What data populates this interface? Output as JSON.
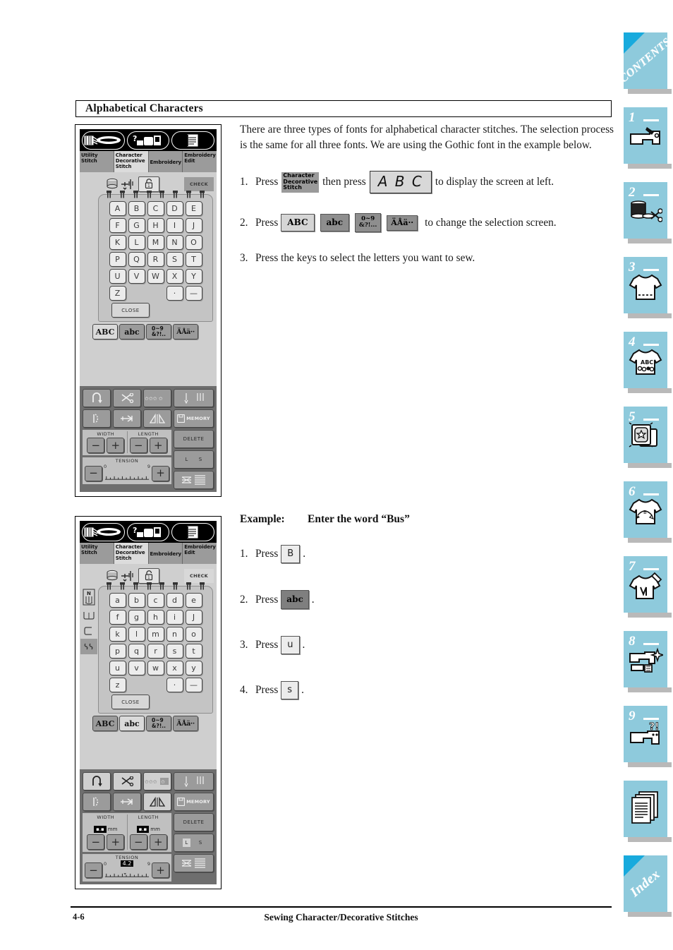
{
  "section": {
    "heading": "Alphabetical Characters"
  },
  "intro": {
    "paragraph": "There are three types of fonts for alphabetical character stitches. The selection process is the same for all three fonts. We are using the Gothic font in the example below."
  },
  "steps": [
    {
      "num": "1.",
      "lead": "Press",
      "chip1_line1": "Character",
      "chip1_line2": "Decorative",
      "chip1_line3": "Stitch",
      "mid": "then press",
      "chip2": "A B C",
      "tail": "to display the screen at left."
    },
    {
      "num": "2.",
      "lead": "Press",
      "keys": [
        "ABC",
        "abc",
        "0~9 &?!...",
        "ÄÅä··"
      ],
      "tail": "to change the selection screen."
    },
    {
      "num": "3.",
      "text": "Press the keys to select the letters you want to sew."
    }
  ],
  "example": {
    "label": "Example:",
    "title": "Enter the word “Bus”",
    "steps": [
      {
        "num": "1.",
        "lead": "Press",
        "key": "B",
        "style": "light",
        "tail": "."
      },
      {
        "num": "2.",
        "lead": "Press",
        "key": "abc",
        "style": "dark",
        "tail": "."
      },
      {
        "num": "3.",
        "lead": "Press",
        "key": "u",
        "style": "light",
        "tail": "."
      },
      {
        "num": "4.",
        "lead": "Press",
        "key": "s",
        "style": "light",
        "tail": "."
      }
    ]
  },
  "lcd1": {
    "tabs": [
      {
        "l1": "Utility",
        "l2": "Stitch",
        "l3": "",
        "active": false
      },
      {
        "l1": "Character",
        "l2": "Decorative",
        "l3": "Stitch",
        "active": true
      },
      {
        "l1": "Embroidery",
        "l2": "",
        "l3": "",
        "active": false
      },
      {
        "l1": "Embroidery",
        "l2": "Edit",
        "l3": "",
        "active": false
      }
    ],
    "check_label": "CHECK",
    "keys": [
      [
        "A",
        "B",
        "C",
        "D",
        "E"
      ],
      [
        "F",
        "G",
        "H",
        "I",
        "J"
      ],
      [
        "K",
        "L",
        "M",
        "N",
        "O"
      ],
      [
        "P",
        "Q",
        "R",
        "S",
        "T"
      ],
      [
        "U",
        "V",
        "W",
        "X",
        "Y"
      ],
      [
        "Z",
        "",
        "",
        "·",
        "—"
      ]
    ],
    "close_label": "CLOSE",
    "fontkeys": [
      {
        "label": "ABC",
        "kind": "light"
      },
      {
        "label": "abc",
        "kind": "dark"
      },
      {
        "label": "0~9\n&?!...",
        "kind": "dark"
      },
      {
        "label": "ÄÅä··",
        "kind": "dark"
      }
    ],
    "deck": {
      "memory_label": "MEMORY",
      "width_label": "WIDTH",
      "length_label": "LENGTH",
      "width_value": "",
      "length_value": "",
      "mm_unit": "",
      "tension_label": "TENSION",
      "tension_min": "0",
      "tension_max": "9",
      "tension_value": "",
      "minus": "−",
      "plus": "+",
      "delete_label": "DELETE",
      "l_label": "L",
      "s_label": "S",
      "l_selected": false
    }
  },
  "lcd2": {
    "tabs": [
      {
        "l1": "Utility",
        "l2": "Stitch",
        "l3": "",
        "active": false
      },
      {
        "l1": "Character",
        "l2": "Decorative",
        "l3": "Stitch",
        "active": true
      },
      {
        "l1": "Embroidery",
        "l2": "",
        "l3": "",
        "active": false
      },
      {
        "l1": "Embroidery",
        "l2": "Edit",
        "l3": "",
        "active": false
      }
    ],
    "check_label": "CHECK",
    "presser_foot_label": "N",
    "keys": [
      [
        "a",
        "b",
        "c",
        "d",
        "e"
      ],
      [
        "f",
        "g",
        "h",
        "i",
        "J"
      ],
      [
        "k",
        "l",
        "m",
        "n",
        "o"
      ],
      [
        "p",
        "q",
        "r",
        "s",
        "t"
      ],
      [
        "u",
        "v",
        "w",
        "x",
        "y"
      ],
      [
        "z",
        "",
        "",
        "·",
        "—"
      ]
    ],
    "close_label": "CLOSE",
    "fontkeys": [
      {
        "label": "ABC",
        "kind": "dark"
      },
      {
        "label": "abc",
        "kind": "light"
      },
      {
        "label": "0~9\n&?!...",
        "kind": "dark"
      },
      {
        "label": "ÄÅä··",
        "kind": "dark"
      }
    ],
    "deck": {
      "memory_label": "MEMORY",
      "width_label": "WIDTH",
      "length_label": "LENGTH",
      "width_value": "▪.▪",
      "length_value": "▪.▪",
      "mm_unit": "mm",
      "tension_label": "TENSION",
      "tension_min": "0",
      "tension_max": "9",
      "tension_value": "4.2",
      "minus": "−",
      "plus": "+",
      "delete_label": "DELETE",
      "l_label": "L",
      "s_label": "S",
      "l_selected": true
    }
  },
  "sidetabs": [
    {
      "kind": "text",
      "label": "CONTENTS"
    },
    {
      "kind": "num",
      "label": "1",
      "icon": "sewing-machine-icon"
    },
    {
      "kind": "num",
      "label": "2",
      "icon": "spool-scissors-icon"
    },
    {
      "kind": "num",
      "label": "3",
      "icon": "tshirt-stitch-icon"
    },
    {
      "kind": "num",
      "label": "4",
      "icon": "tshirt-abc-icon"
    },
    {
      "kind": "num",
      "label": "5",
      "icon": "embroidery-card-icon"
    },
    {
      "kind": "num",
      "label": "6",
      "icon": "tshirt-monogram-icon"
    },
    {
      "kind": "num",
      "label": "7",
      "icon": "tshirt-applique-icon"
    },
    {
      "kind": "num",
      "label": "8",
      "icon": "machine-cleaning-icon"
    },
    {
      "kind": "num",
      "label": "9",
      "icon": "machine-question-icon"
    },
    {
      "kind": "plain",
      "label": "",
      "icon": "pages-icon"
    },
    {
      "kind": "text",
      "label": "Index"
    }
  ],
  "footer": {
    "page_number": "4-6",
    "chapter_title": "Sewing Character/Decorative Stitches"
  }
}
